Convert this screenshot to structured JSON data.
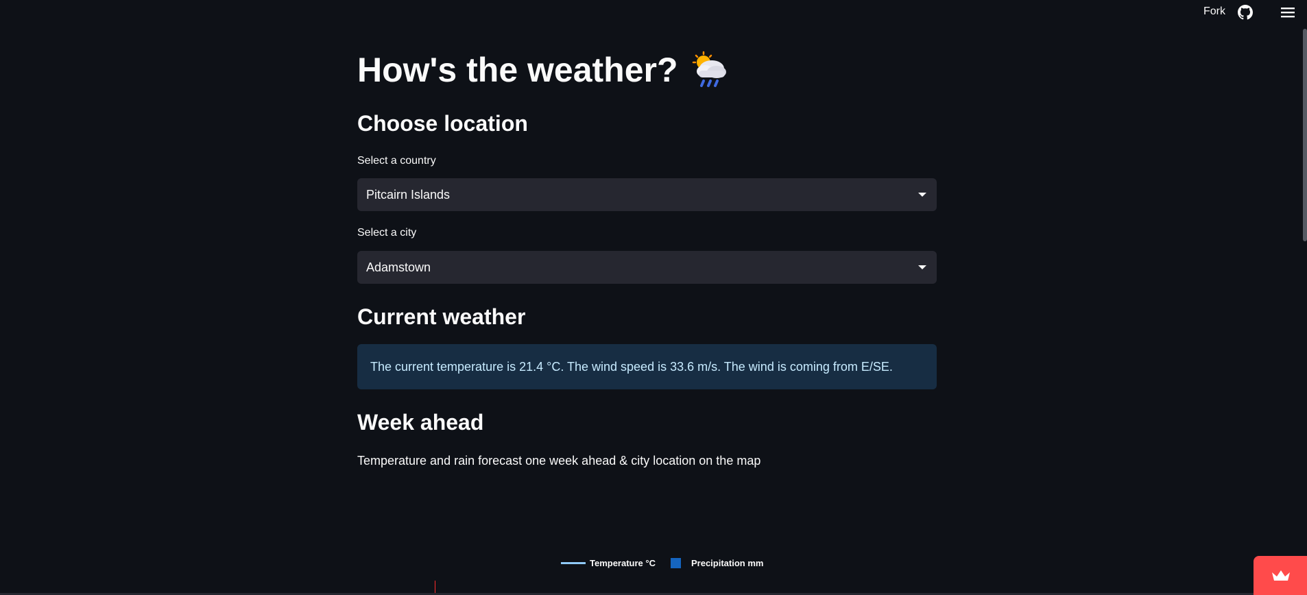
{
  "header": {
    "fork_label": "Fork",
    "github_icon": "github-icon",
    "menu_icon": "hamburger-menu-icon"
  },
  "page": {
    "title": "How's the weather?",
    "title_icon": "sun-behind-rain-cloud-icon"
  },
  "location": {
    "heading": "Choose location",
    "country": {
      "label": "Select a country",
      "value": "Pitcairn Islands"
    },
    "city": {
      "label": "Select a city",
      "value": "Adamstown"
    }
  },
  "current": {
    "heading": "Current weather",
    "message": "The current temperature is 21.4 °C. The wind speed is 33.6 m/s. The wind is coming from E/SE."
  },
  "week": {
    "heading": "Week ahead",
    "description": "Temperature and rain forecast one week ahead & city location on the map"
  },
  "chart_legend": {
    "temperature_label": "Temperature °C",
    "precipitation_label": "Precipitation mm"
  },
  "colors": {
    "background": "#0e1117",
    "info_background": "#172d43",
    "info_text": "#c7ebff",
    "select_background": "#262730",
    "temperature_line": "#90caf9",
    "precipitation_bar": "#1565c0",
    "badge": "#ff4b4b"
  },
  "footer": {
    "badge_icon": "streamlit-crown-icon"
  }
}
